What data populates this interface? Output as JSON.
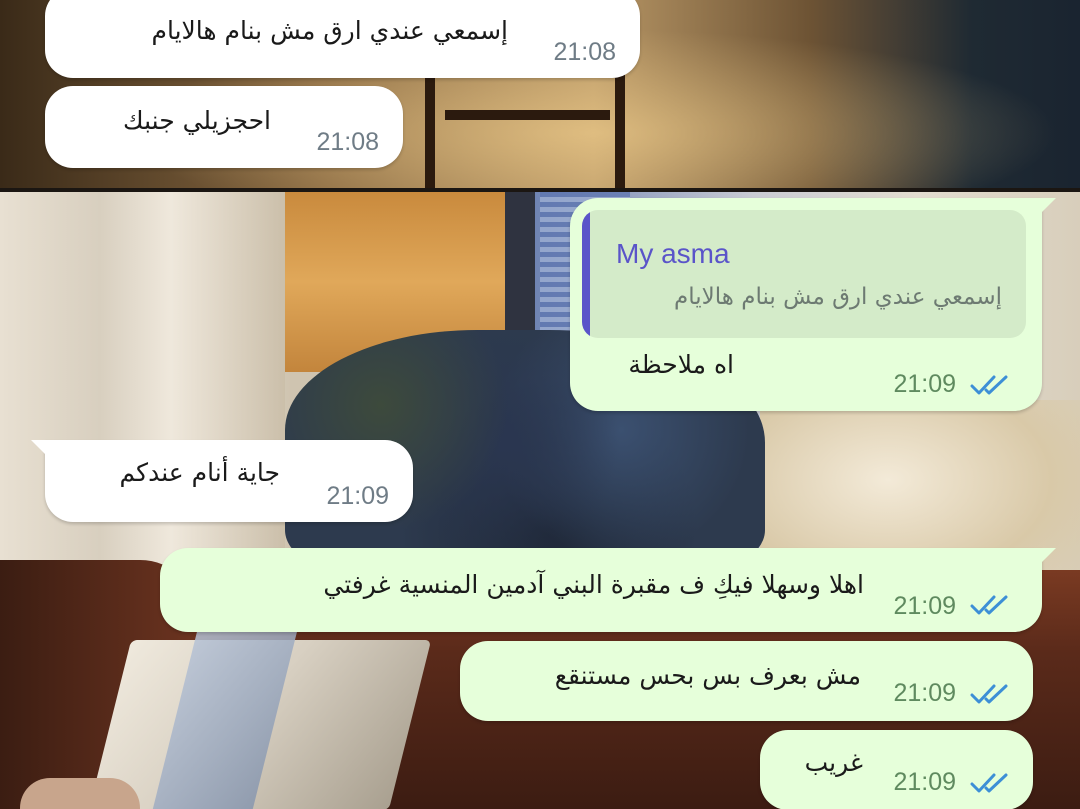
{
  "messages": [
    {
      "direction": "incoming",
      "text": "إسمعي عندي ارق مش بنام هالايام",
      "time": "21:08"
    },
    {
      "direction": "incoming",
      "text": "احجزيلي جنبك",
      "time": "21:08"
    },
    {
      "direction": "outgoing",
      "reply": {
        "name": "My asma",
        "text": "إسمعي عندي ارق مش بنام هالايام"
      },
      "text": "اه ملاحظة",
      "time": "21:09",
      "status": "read"
    },
    {
      "direction": "incoming",
      "text": "جاية أنام عندكم",
      "time": "21:09"
    },
    {
      "direction": "outgoing",
      "text": "اهلا وسهلا فيكِ ف مقبرة البني آدمين المنسية غرفتي",
      "time": "21:09",
      "status": "read"
    },
    {
      "direction": "outgoing",
      "text": "مش بعرف بس بحس مستنقع",
      "time": "21:09",
      "status": "read"
    },
    {
      "direction": "outgoing",
      "text": "غريب",
      "time": "21:09",
      "status": "read"
    }
  ],
  "colors": {
    "incoming_bubble": "#ffffff",
    "outgoing_bubble": "#e6ffda",
    "reply_accent": "#5a54c9",
    "read_ticks": "#3d8fd6"
  },
  "icons": {
    "read_status": "double-check-icon"
  }
}
